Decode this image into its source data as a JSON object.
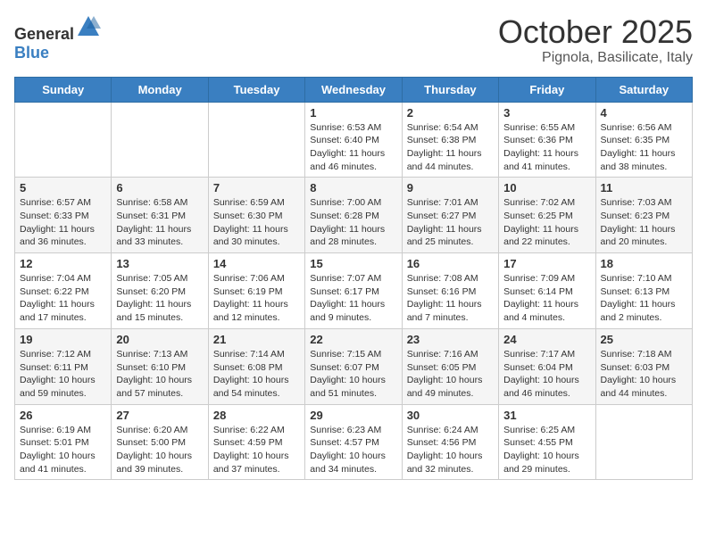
{
  "header": {
    "logo_general": "General",
    "logo_blue": "Blue",
    "month": "October 2025",
    "location": "Pignola, Basilicate, Italy"
  },
  "weekdays": [
    "Sunday",
    "Monday",
    "Tuesday",
    "Wednesday",
    "Thursday",
    "Friday",
    "Saturday"
  ],
  "weeks": [
    [
      {
        "day": "",
        "info": ""
      },
      {
        "day": "",
        "info": ""
      },
      {
        "day": "",
        "info": ""
      },
      {
        "day": "1",
        "info": "Sunrise: 6:53 AM\nSunset: 6:40 PM\nDaylight: 11 hours\nand 46 minutes."
      },
      {
        "day": "2",
        "info": "Sunrise: 6:54 AM\nSunset: 6:38 PM\nDaylight: 11 hours\nand 44 minutes."
      },
      {
        "day": "3",
        "info": "Sunrise: 6:55 AM\nSunset: 6:36 PM\nDaylight: 11 hours\nand 41 minutes."
      },
      {
        "day": "4",
        "info": "Sunrise: 6:56 AM\nSunset: 6:35 PM\nDaylight: 11 hours\nand 38 minutes."
      }
    ],
    [
      {
        "day": "5",
        "info": "Sunrise: 6:57 AM\nSunset: 6:33 PM\nDaylight: 11 hours\nand 36 minutes."
      },
      {
        "day": "6",
        "info": "Sunrise: 6:58 AM\nSunset: 6:31 PM\nDaylight: 11 hours\nand 33 minutes."
      },
      {
        "day": "7",
        "info": "Sunrise: 6:59 AM\nSunset: 6:30 PM\nDaylight: 11 hours\nand 30 minutes."
      },
      {
        "day": "8",
        "info": "Sunrise: 7:00 AM\nSunset: 6:28 PM\nDaylight: 11 hours\nand 28 minutes."
      },
      {
        "day": "9",
        "info": "Sunrise: 7:01 AM\nSunset: 6:27 PM\nDaylight: 11 hours\nand 25 minutes."
      },
      {
        "day": "10",
        "info": "Sunrise: 7:02 AM\nSunset: 6:25 PM\nDaylight: 11 hours\nand 22 minutes."
      },
      {
        "day": "11",
        "info": "Sunrise: 7:03 AM\nSunset: 6:23 PM\nDaylight: 11 hours\nand 20 minutes."
      }
    ],
    [
      {
        "day": "12",
        "info": "Sunrise: 7:04 AM\nSunset: 6:22 PM\nDaylight: 11 hours\nand 17 minutes."
      },
      {
        "day": "13",
        "info": "Sunrise: 7:05 AM\nSunset: 6:20 PM\nDaylight: 11 hours\nand 15 minutes."
      },
      {
        "day": "14",
        "info": "Sunrise: 7:06 AM\nSunset: 6:19 PM\nDaylight: 11 hours\nand 12 minutes."
      },
      {
        "day": "15",
        "info": "Sunrise: 7:07 AM\nSunset: 6:17 PM\nDaylight: 11 hours\nand 9 minutes."
      },
      {
        "day": "16",
        "info": "Sunrise: 7:08 AM\nSunset: 6:16 PM\nDaylight: 11 hours\nand 7 minutes."
      },
      {
        "day": "17",
        "info": "Sunrise: 7:09 AM\nSunset: 6:14 PM\nDaylight: 11 hours\nand 4 minutes."
      },
      {
        "day": "18",
        "info": "Sunrise: 7:10 AM\nSunset: 6:13 PM\nDaylight: 11 hours\nand 2 minutes."
      }
    ],
    [
      {
        "day": "19",
        "info": "Sunrise: 7:12 AM\nSunset: 6:11 PM\nDaylight: 10 hours\nand 59 minutes."
      },
      {
        "day": "20",
        "info": "Sunrise: 7:13 AM\nSunset: 6:10 PM\nDaylight: 10 hours\nand 57 minutes."
      },
      {
        "day": "21",
        "info": "Sunrise: 7:14 AM\nSunset: 6:08 PM\nDaylight: 10 hours\nand 54 minutes."
      },
      {
        "day": "22",
        "info": "Sunrise: 7:15 AM\nSunset: 6:07 PM\nDaylight: 10 hours\nand 51 minutes."
      },
      {
        "day": "23",
        "info": "Sunrise: 7:16 AM\nSunset: 6:05 PM\nDaylight: 10 hours\nand 49 minutes."
      },
      {
        "day": "24",
        "info": "Sunrise: 7:17 AM\nSunset: 6:04 PM\nDaylight: 10 hours\nand 46 minutes."
      },
      {
        "day": "25",
        "info": "Sunrise: 7:18 AM\nSunset: 6:03 PM\nDaylight: 10 hours\nand 44 minutes."
      }
    ],
    [
      {
        "day": "26",
        "info": "Sunrise: 6:19 AM\nSunset: 5:01 PM\nDaylight: 10 hours\nand 41 minutes."
      },
      {
        "day": "27",
        "info": "Sunrise: 6:20 AM\nSunset: 5:00 PM\nDaylight: 10 hours\nand 39 minutes."
      },
      {
        "day": "28",
        "info": "Sunrise: 6:22 AM\nSunset: 4:59 PM\nDaylight: 10 hours\nand 37 minutes."
      },
      {
        "day": "29",
        "info": "Sunrise: 6:23 AM\nSunset: 4:57 PM\nDaylight: 10 hours\nand 34 minutes."
      },
      {
        "day": "30",
        "info": "Sunrise: 6:24 AM\nSunset: 4:56 PM\nDaylight: 10 hours\nand 32 minutes."
      },
      {
        "day": "31",
        "info": "Sunrise: 6:25 AM\nSunset: 4:55 PM\nDaylight: 10 hours\nand 29 minutes."
      },
      {
        "day": "",
        "info": ""
      }
    ]
  ]
}
